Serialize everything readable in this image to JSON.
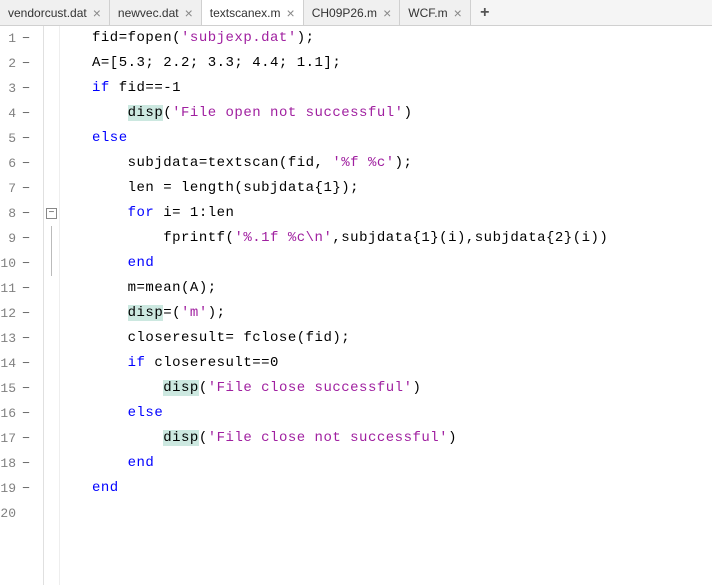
{
  "tabs": [
    {
      "label": "vendorcust.dat",
      "active": false
    },
    {
      "label": "newvec.dat",
      "active": false
    },
    {
      "label": "textscanex.m",
      "active": true
    },
    {
      "label": "CH09P26.m",
      "active": false
    },
    {
      "label": "WCF.m",
      "active": false
    }
  ],
  "close_glyph": "×",
  "add_glyph": "+",
  "fold_glyph": "−",
  "gutter": [
    {
      "num": "1",
      "dash": true,
      "fold": ""
    },
    {
      "num": "2",
      "dash": true,
      "fold": ""
    },
    {
      "num": "3",
      "dash": true,
      "fold": ""
    },
    {
      "num": "4",
      "dash": true,
      "fold": ""
    },
    {
      "num": "5",
      "dash": true,
      "fold": ""
    },
    {
      "num": "6",
      "dash": true,
      "fold": ""
    },
    {
      "num": "7",
      "dash": true,
      "fold": ""
    },
    {
      "num": "8",
      "dash": true,
      "fold": "box"
    },
    {
      "num": "9",
      "dash": true,
      "fold": "line"
    },
    {
      "num": "10",
      "dash": true,
      "fold": "line"
    },
    {
      "num": "11",
      "dash": true,
      "fold": ""
    },
    {
      "num": "12",
      "dash": true,
      "fold": ""
    },
    {
      "num": "13",
      "dash": true,
      "fold": ""
    },
    {
      "num": "14",
      "dash": true,
      "fold": ""
    },
    {
      "num": "15",
      "dash": true,
      "fold": ""
    },
    {
      "num": "16",
      "dash": true,
      "fold": ""
    },
    {
      "num": "17",
      "dash": true,
      "fold": ""
    },
    {
      "num": "18",
      "dash": true,
      "fold": ""
    },
    {
      "num": "19",
      "dash": true,
      "fold": ""
    },
    {
      "num": "20",
      "dash": false,
      "fold": ""
    }
  ],
  "code": {
    "l1": {
      "p1": "fid=fopen(",
      "s1": "'subjexp.dat'",
      "p2": ");"
    },
    "l2": {
      "p1": "A=[5.3; 2.2; 3.3; 4.4; 1.1];"
    },
    "l3": {
      "k1": "if",
      "p1": " fid==-1"
    },
    "l4": {
      "f1": "disp",
      "p1": "(",
      "s1": "'File open not successful'",
      "p2": ")"
    },
    "l5": {
      "k1": "else"
    },
    "l6": {
      "p1": "subjdata=textscan(fid, ",
      "s1": "'%f %c'",
      "p2": ");"
    },
    "l7": {
      "p1": "len = length(subjdata{1});"
    },
    "l8": {
      "k1": "for",
      "p1": " i= 1:len"
    },
    "l9": {
      "p1": "fprintf(",
      "s1": "'%.1f %c\\n'",
      "p2": ",subjdata{1}(i),subjdata{2}(i))"
    },
    "l10": {
      "k1": "end"
    },
    "l11": {
      "p1": "m=mean(A);"
    },
    "l12": {
      "f1": "disp",
      "p1": "=(",
      "s1": "'m'",
      "p2": ");"
    },
    "l13": {
      "p1": "closeresult= fclose(fid);"
    },
    "l14": {
      "k1": "if",
      "p1": " closeresult==0"
    },
    "l15": {
      "f1": "disp",
      "p1": "(",
      "s1": "'File close successful'",
      "p2": ")"
    },
    "l16": {
      "k1": "else"
    },
    "l17": {
      "f1": "disp",
      "p1": "(",
      "s1": "'File close not successful'",
      "p2": ")"
    },
    "l18": {
      "k1": "end"
    },
    "l19": {
      "k1": "end"
    }
  }
}
